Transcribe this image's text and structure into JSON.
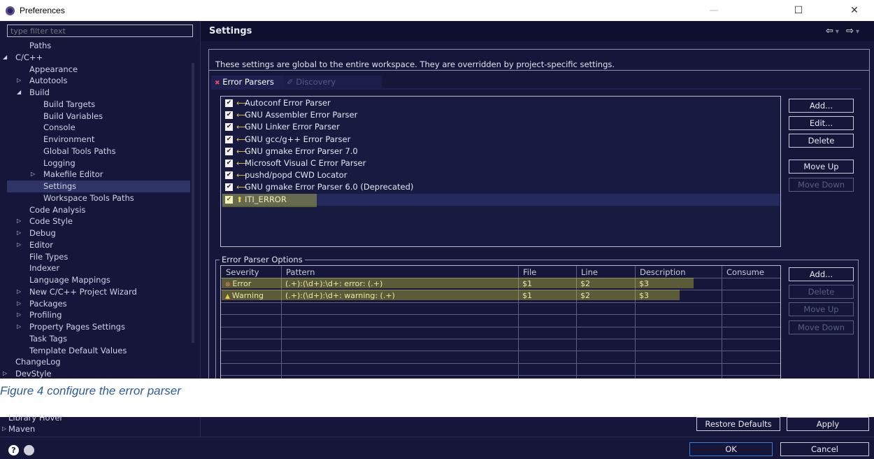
{
  "window": {
    "title": "Preferences",
    "minimize": "—",
    "maximize": "☐",
    "close": "✕"
  },
  "filter": {
    "placeholder": "type filter text"
  },
  "tree": {
    "items": [
      {
        "label": "Paths",
        "indent": 1,
        "arrow": ""
      },
      {
        "label": "C/C++",
        "indent": 0,
        "arrow": "expanded"
      },
      {
        "label": "Appearance",
        "indent": 1,
        "arrow": ""
      },
      {
        "label": "Autotools",
        "indent": 1,
        "arrow": "collapsed"
      },
      {
        "label": "Build",
        "indent": 1,
        "arrow": "expanded"
      },
      {
        "label": "Build Targets",
        "indent": 2,
        "arrow": ""
      },
      {
        "label": "Build Variables",
        "indent": 2,
        "arrow": ""
      },
      {
        "label": "Console",
        "indent": 2,
        "arrow": ""
      },
      {
        "label": "Environment",
        "indent": 2,
        "arrow": ""
      },
      {
        "label": "Global Tools Paths",
        "indent": 2,
        "arrow": ""
      },
      {
        "label": "Logging",
        "indent": 2,
        "arrow": ""
      },
      {
        "label": "Makefile Editor",
        "indent": 2,
        "arrow": "collapsed"
      },
      {
        "label": "Settings",
        "indent": 2,
        "arrow": "",
        "selected": true
      },
      {
        "label": "Workspace Tools Paths",
        "indent": 2,
        "arrow": ""
      },
      {
        "label": "Code Analysis",
        "indent": 1,
        "arrow": ""
      },
      {
        "label": "Code Style",
        "indent": 1,
        "arrow": "collapsed"
      },
      {
        "label": "Debug",
        "indent": 1,
        "arrow": "collapsed"
      },
      {
        "label": "Editor",
        "indent": 1,
        "arrow": "collapsed"
      },
      {
        "label": "File Types",
        "indent": 1,
        "arrow": ""
      },
      {
        "label": "Indexer",
        "indent": 1,
        "arrow": ""
      },
      {
        "label": "Language Mappings",
        "indent": 1,
        "arrow": ""
      },
      {
        "label": "New C/C++ Project Wizard",
        "indent": 1,
        "arrow": "collapsed"
      },
      {
        "label": "Packages",
        "indent": 1,
        "arrow": "collapsed"
      },
      {
        "label": "Profiling",
        "indent": 1,
        "arrow": "collapsed"
      },
      {
        "label": "Property Pages Settings",
        "indent": 1,
        "arrow": "collapsed"
      },
      {
        "label": "Task Tags",
        "indent": 1,
        "arrow": ""
      },
      {
        "label": "Template Default Values",
        "indent": 1,
        "arrow": ""
      },
      {
        "label": "ChangeLog",
        "indent": 0,
        "arrow": ""
      },
      {
        "label": "DevStyle",
        "indent": 0,
        "arrow": "collapsed"
      }
    ],
    "peek_items": [
      "Library Hover",
      "Maven"
    ]
  },
  "settings": {
    "title": "Settings",
    "description": "These settings are global to the entire workspace.  They are overridden by project-specific settings.",
    "nav": {
      "back": "⇦",
      "forward": "⇨"
    }
  },
  "tabs": [
    {
      "label": "Error Parsers",
      "active": true
    },
    {
      "label": "Discovery",
      "active": false
    }
  ],
  "parsers": [
    {
      "label": "Autoconf Error Parser",
      "checked": true
    },
    {
      "label": "GNU Assembler Error Parser",
      "checked": true
    },
    {
      "label": "GNU Linker Error Parser",
      "checked": true
    },
    {
      "label": "GNU gcc/g++ Error Parser",
      "checked": true
    },
    {
      "label": "GNU gmake Error Parser 7.0",
      "checked": true
    },
    {
      "label": "Microsoft Visual C Error Parser",
      "checked": true
    },
    {
      "label": "pushd/popd CWD Locator",
      "checked": true
    },
    {
      "label": "GNU gmake Error Parser 6.0 (Deprecated)",
      "checked": true
    },
    {
      "label": "ITI_ERROR",
      "checked": true,
      "highlighted": true
    }
  ],
  "parser_buttons": {
    "add": "Add...",
    "edit": "Edit...",
    "delete": "Delete",
    "move_up": "Move Up",
    "move_down": "Move Down"
  },
  "options": {
    "group_label": "Error Parser Options",
    "columns": [
      "Severity",
      "Pattern",
      "File",
      "Line",
      "Description",
      "Consume"
    ],
    "rows": [
      {
        "severity": "Error",
        "pattern": "(.+):(\\d+):\\d+: error: (.+)",
        "file": "$1",
        "line": "$2",
        "description": "$3",
        "consume": ""
      },
      {
        "severity": "Warning",
        "pattern": "(.+):(\\d+):\\d+: warning: (.+)",
        "file": "$1",
        "line": "$2",
        "description": "$3",
        "consume": ""
      }
    ],
    "buttons": {
      "add": "Add...",
      "delete": "Delete",
      "move_up": "Move Up",
      "move_down": "Move Down"
    }
  },
  "caption": "Figure 4 configure the error parser",
  "footer": {
    "restore_defaults": "Restore Defaults",
    "apply": "Apply",
    "ok": "OK",
    "cancel": "Cancel",
    "help_icon": "?"
  },
  "colors": {
    "background": "#15163a",
    "highlight": "#ffff33",
    "selected": "#2f3466",
    "caption": "#2b5c9a"
  }
}
